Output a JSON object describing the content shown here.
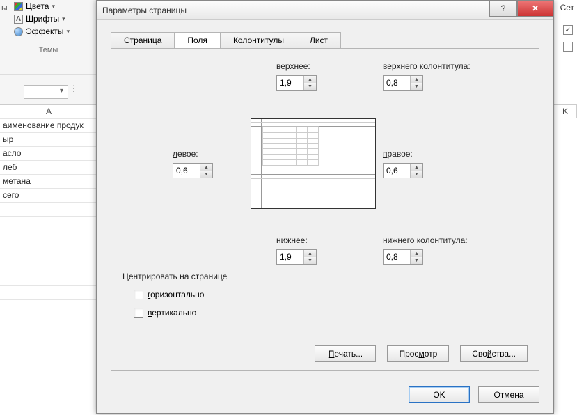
{
  "ribbon": {
    "colors_label": "Цвета",
    "fonts_label": "Шрифты",
    "effects_label": "Эффекты",
    "themes_label": "Темы",
    "truncated_y": "ы"
  },
  "right_panel": {
    "grid_label": "Сет",
    "checkbox1_checked": true,
    "checkbox2_checked": false
  },
  "sheet": {
    "col_a": "A",
    "col_k": "K",
    "rows": [
      "аименование продук",
      "ыр",
      "асло",
      "леб",
      "метана",
      "сего",
      "",
      "",
      "",
      "",
      "",
      "",
      "",
      ""
    ]
  },
  "dialog": {
    "title": "Параметры страницы",
    "tabs": {
      "page": "Страница",
      "margins": "Поля",
      "headers": "Колонтитулы",
      "sheet": "Лист"
    },
    "margins": {
      "top_label": "верхнее:",
      "top_value": "1,9",
      "header_label": "верхнего колонтитула:",
      "header_value": "0,8",
      "left_label": "левое:",
      "left_value": "0,6",
      "right_label": "правое:",
      "right_value": "0,6",
      "bottom_label": "нижнее:",
      "bottom_value": "1,9",
      "footer_label": "нижнего колонтитула:",
      "footer_value": "0,8"
    },
    "center": {
      "group_label": "Центрировать на странице",
      "horizontal": "горизонтально",
      "vertical": "вертикально"
    },
    "buttons": {
      "print": "Печать...",
      "preview": "Просмотр",
      "properties": "Свойства...",
      "ok": "OK",
      "cancel": "Отмена"
    }
  }
}
